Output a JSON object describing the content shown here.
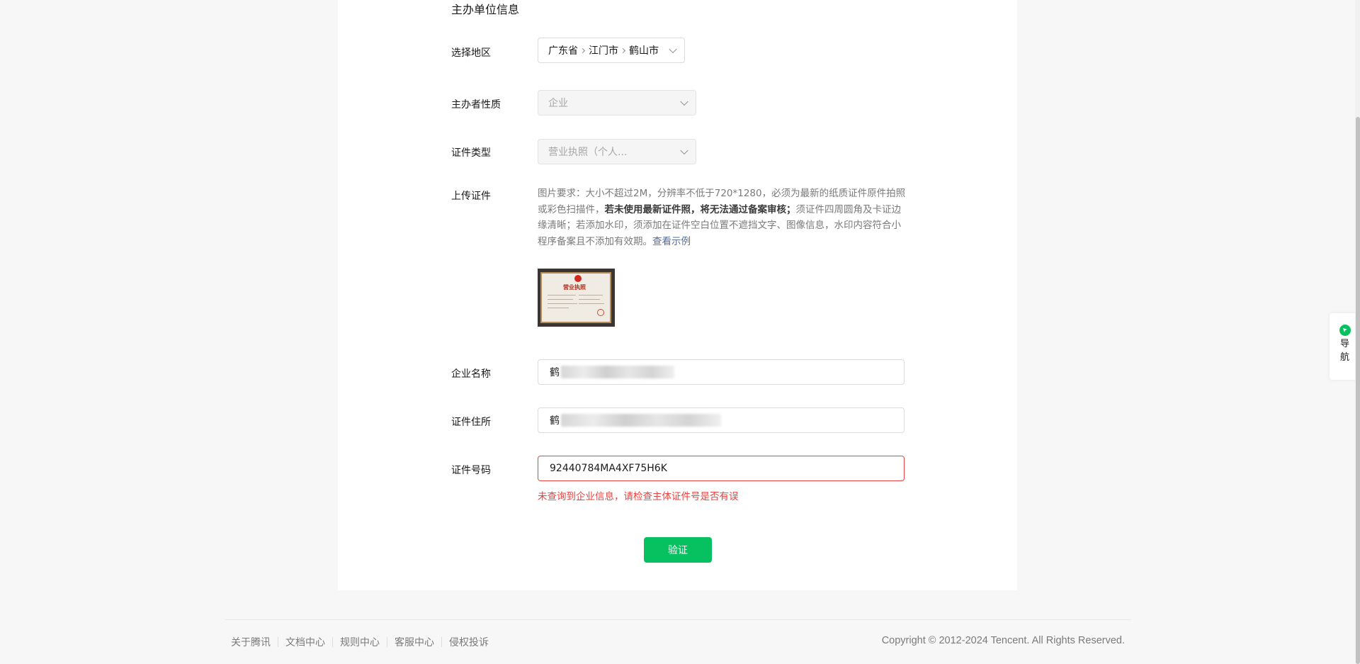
{
  "section": {
    "title": "主办单位信息"
  },
  "form": {
    "region": {
      "label": "选择地区",
      "province": "广东省",
      "city": "江门市",
      "district": "鹤山市"
    },
    "owner_type": {
      "label": "主办者性质",
      "value": "企业"
    },
    "cert_type": {
      "label": "证件类型",
      "value": "营业执照（个人..."
    },
    "upload": {
      "label": "上传证件",
      "desc_part1": "图片要求：大小不超过2M，分辨率不低于720*1280，必须为最新的纸质证件原件拍照或彩色扫描件，",
      "desc_bold": "若未使用最新证件照，将无法通过备案审核；",
      "desc_part2": "须证件四周圆角及卡证边缘清晰；若添加水印，须添加在证件空白位置不遮挡文字、图像信息，水印内容符合小程序备案且不添加有效期。",
      "example_link": "查看示例",
      "thumb_title": "营业执照"
    },
    "company_name": {
      "label": "企业名称",
      "value_prefix": "鹤"
    },
    "cert_address": {
      "label": "证件住所",
      "value_prefix": "鹤"
    },
    "cert_number": {
      "label": "证件号码",
      "value": "92440784MA4XF75H6K"
    },
    "error_message": "未查询到企业信息，请检查主体证件号是否有误",
    "verify_button": "验证"
  },
  "footer": {
    "links": [
      "关于腾讯",
      "文档中心",
      "规则中心",
      "客服中心",
      "侵权投诉"
    ],
    "copyright": "Copyright © 2012-2024 Tencent. All Rights Reserved."
  },
  "side_nav": {
    "label": "导航"
  },
  "colors": {
    "primary": "#07c160",
    "error": "#e64340",
    "link": "#576b95"
  }
}
